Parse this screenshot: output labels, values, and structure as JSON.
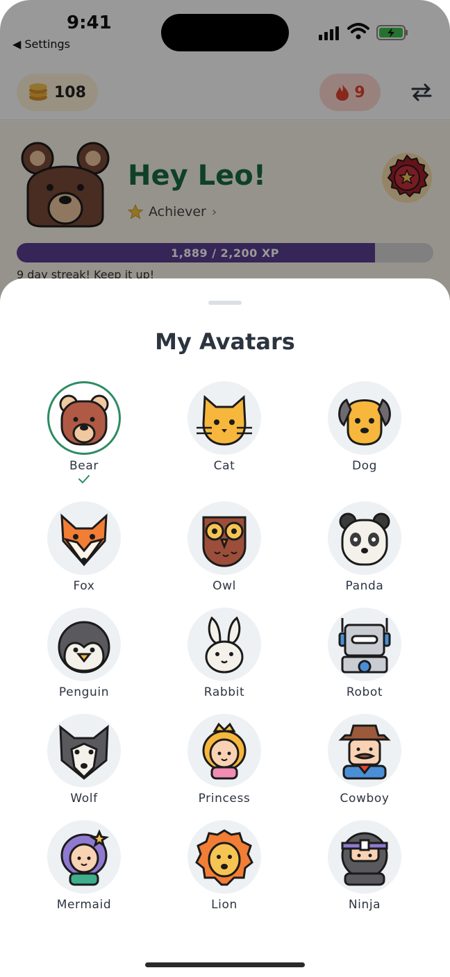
{
  "status_bar": {
    "time": "9:41",
    "back_label": "◀ Settings"
  },
  "header": {
    "coins": "108",
    "streak": "9"
  },
  "profile": {
    "greeting": "Hey Leo!",
    "rank": "Achiever",
    "xp_text": "1,889 / 2,200 XP",
    "xp_progress": 0.86,
    "streak_message": "9 day streak! Keep it up!"
  },
  "sheet": {
    "title": "My Avatars",
    "selected": "Bear",
    "avatars": [
      {
        "name": "Bear"
      },
      {
        "name": "Cat"
      },
      {
        "name": "Dog"
      },
      {
        "name": "Fox"
      },
      {
        "name": "Owl"
      },
      {
        "name": "Panda"
      },
      {
        "name": "Penguin"
      },
      {
        "name": "Rabbit"
      },
      {
        "name": "Robot"
      },
      {
        "name": "Wolf"
      },
      {
        "name": "Princess"
      },
      {
        "name": "Cowboy"
      },
      {
        "name": "Mermaid"
      },
      {
        "name": "Lion"
      },
      {
        "name": "Ninja"
      }
    ]
  },
  "colors": {
    "accent_green": "#1a6b45",
    "xp_purple": "#5b3f92",
    "selected_ring": "#2e8b63",
    "streak_red": "#e2442f"
  }
}
